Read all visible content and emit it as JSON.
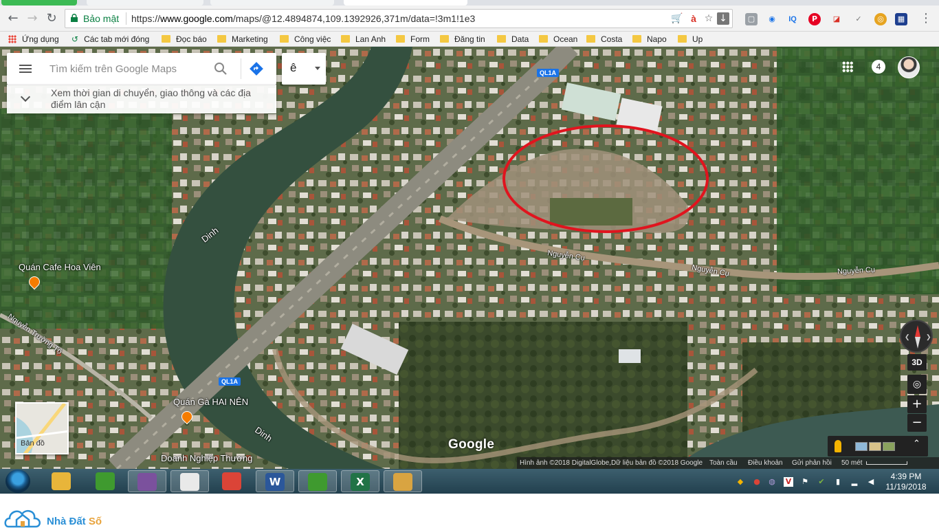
{
  "browser": {
    "address": {
      "secure_label": "Bảo mật",
      "url_prefix": "https://",
      "url_host": "www.google.com",
      "url_path": "/maps/@12.4894874,109.1392926,371m/data=!3m1!1e3",
      "translate_glyph": "à"
    },
    "bookmarks": [
      {
        "label": "Ứng dụng",
        "icon": "apps-icon"
      },
      {
        "label": "Các tab mới đóng",
        "icon": "history-icon"
      },
      {
        "label": "Đọc báo",
        "icon": "folder-icon"
      },
      {
        "label": "Marketing",
        "icon": "folder-icon"
      },
      {
        "label": "Công việc",
        "icon": "folder-icon"
      },
      {
        "label": "Lan Anh",
        "icon": "folder-icon"
      },
      {
        "label": "Form",
        "icon": "folder-icon"
      },
      {
        "label": "Đăng tin",
        "icon": "folder-icon"
      },
      {
        "label": "Data",
        "icon": "folder-icon"
      },
      {
        "label": "Ocean",
        "icon": "folder-icon"
      },
      {
        "label": "Costa",
        "icon": "folder-icon"
      },
      {
        "label": "Napo",
        "icon": "folder-icon"
      },
      {
        "label": "Up",
        "icon": "folder-icon"
      }
    ],
    "extensions": {
      "iq_label": "IQ"
    }
  },
  "maps": {
    "search": {
      "placeholder": "Tìm kiếm trên Google Maps"
    },
    "language_label": "ê",
    "explore_text": "Xem thời gian di chuyển, giao thông và các địa điểm lân cận",
    "notifications_count": "4",
    "labels": {
      "river_1": "Dinh",
      "river_2": "Dinh",
      "cafe": "Quán Cafe Hoa Viên",
      "restaurant": "Quán Gà HAI NÊN",
      "company": "Doanh Nghiệp Thương",
      "road_nguyen_cu_1": "Nguyễn Cụ",
      "road_nguyen_cu_2": "Nguyễn Cụ",
      "road_nguyen_cu_3": "Nguyễn Cụ",
      "road_nguyen_truong_to": "Nguyễn Trường Tộ",
      "shield_1": "QL1A",
      "shield_2": "QL1A"
    },
    "tilt_label": "3D",
    "zoom_in": "+",
    "zoom_out": "−",
    "minimap_label": "Bản đồ",
    "google_logo": "Google",
    "attribution": {
      "imagery": "Hình ảnh ©2018 DigitalGlobe,Dữ liệu bản đồ ©2018 Google",
      "global": "Toàn cầu",
      "terms": "Điều khoản",
      "feedback": "Gửi phản hồi",
      "scale": "50 mét"
    },
    "highlight_color": "#e0141e"
  },
  "taskbar": {
    "apps": [
      {
        "name": "file-explorer-icon",
        "color": "#e8b53a",
        "glyph": ""
      },
      {
        "name": "coccoc-icon",
        "color": "#3f9a2f",
        "glyph": ""
      },
      {
        "name": "viber-icon",
        "color": "#7b519d",
        "glyph": ""
      },
      {
        "name": "notepad-icon",
        "color": "#e9e9e9",
        "glyph": ""
      },
      {
        "name": "chrome-icon",
        "color": "#db4437",
        "glyph": ""
      },
      {
        "name": "word-icon",
        "color": "#2b579a",
        "glyph": "W"
      },
      {
        "name": "coccoc-2-icon",
        "color": "#3f9a2f",
        "glyph": ""
      },
      {
        "name": "excel-icon",
        "color": "#217346",
        "glyph": "X"
      },
      {
        "name": "paint-icon",
        "color": "#d9a441",
        "glyph": ""
      }
    ],
    "clock": {
      "time": "4:39 PM",
      "date": "11/19/2018"
    }
  },
  "footer": {
    "brand_1": "Nhà Đất ",
    "brand_2": "Số"
  }
}
